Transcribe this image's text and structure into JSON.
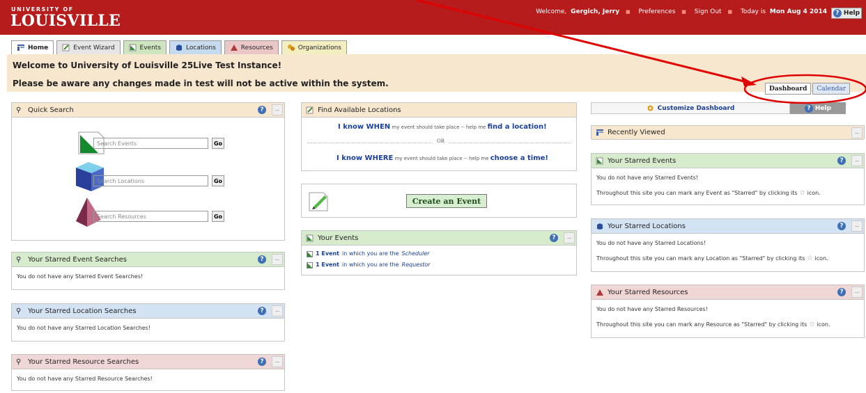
{
  "header": {
    "logo_small": "UNIVERSITY OF",
    "logo_big": "LOUISVILLE",
    "welcome_prefix": "Welcome,",
    "user": "Gergich, Jerry",
    "preferences": "Preferences",
    "sign_out": "Sign Out",
    "today_prefix": "Today is",
    "today": "Mon Aug 4 2014",
    "help": "Help"
  },
  "tabs": [
    {
      "label": "Home"
    },
    {
      "label": "Event Wizard"
    },
    {
      "label": "Events"
    },
    {
      "label": "Locations"
    },
    {
      "label": "Resources"
    },
    {
      "label": "Organizations"
    }
  ],
  "banner": {
    "line1": "Welcome to University of Louisville 25Live Test Instance!",
    "line2": "Please be aware any changes made in test will not be active within the system."
  },
  "view_tabs": {
    "dashboard": "Dashboard",
    "calendar": "Calendar"
  },
  "quick_search": {
    "title": "Quick Search",
    "events_placeholder": "Search Events",
    "locations_placeholder": "Search Locations",
    "resources_placeholder": "Search Resources",
    "go": "Go"
  },
  "starred_event_searches": {
    "title": "Your Starred Event Searches",
    "empty": "You do not have any Starred Event Searches!"
  },
  "starred_location_searches": {
    "title": "Your Starred Location Searches",
    "empty": "You do not have any Starred Location Searches!"
  },
  "starred_resource_searches": {
    "title": "Your Starred Resource Searches",
    "empty": "You do not have any Starred Resource Searches!"
  },
  "find_locations": {
    "title": "Find Available Locations",
    "when_a": "I know WHEN",
    "when_b": "my event should take place -- help me",
    "when_c": "find a location!",
    "or": "OR",
    "where_a": "I know WHERE",
    "where_b": "my event should take place -- help me",
    "where_c": "choose a time!"
  },
  "create_event": {
    "label": "Create an Event"
  },
  "your_events": {
    "title": "Your Events",
    "items": [
      {
        "count": "1 Event",
        "middle": "in which you are the",
        "role": "Scheduler"
      },
      {
        "count": "1 Event",
        "middle": "in which you are the",
        "role": "Requestor"
      }
    ]
  },
  "customize": {
    "label": "Customize Dashboard",
    "help": "Help"
  },
  "recently_viewed": {
    "title": "Recently Viewed"
  },
  "starred_events": {
    "title": "Your Starred Events",
    "empty": "You do not have any Starred Events!",
    "hint_a": "Throughout this site you can mark any Event as \"Starred\" by clicking its",
    "hint_b": "icon."
  },
  "starred_locations": {
    "title": "Your Starred Locations",
    "empty": "You do not have any Starred Locations!",
    "hint_a": "Throughout this site you can mark any Location as \"Starred\" by clicking its",
    "hint_b": "icon."
  },
  "starred_resources": {
    "title": "Your Starred Resources",
    "empty": "You do not have any Starred Resources!",
    "hint_a": "Throughout this site you can mark any Resource as \"Starred\" by clicking its",
    "hint_b": "icon."
  },
  "colors": {
    "brand": "#b71c1c",
    "annotation": "#e00000",
    "link": "#1a3f99"
  }
}
